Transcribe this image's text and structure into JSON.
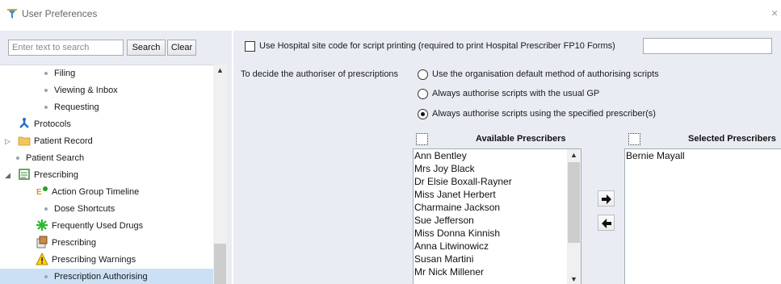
{
  "window": {
    "title": "User Preferences",
    "close_glyph": "×"
  },
  "search": {
    "placeholder": "Enter text to search",
    "search_label": "Search",
    "clear_label": "Clear"
  },
  "tree": {
    "items": [
      {
        "label": "Filing",
        "icon": "bullet"
      },
      {
        "label": "Viewing & Inbox",
        "icon": "bullet"
      },
      {
        "label": "Requesting",
        "icon": "bullet"
      },
      {
        "label": "Protocols",
        "icon": "protocols-icon"
      },
      {
        "label": "Patient Record",
        "icon": "folder-icon"
      },
      {
        "label": "Patient Search",
        "icon": "bullet"
      },
      {
        "label": "Prescribing",
        "icon": "prescribing-folder-icon"
      },
      {
        "label": "Action Group Timeline",
        "icon": "timeline-icon"
      },
      {
        "label": "Dose Shortcuts",
        "icon": "bullet"
      },
      {
        "label": "Frequently Used Drugs",
        "icon": "star-icon"
      },
      {
        "label": "Prescribing",
        "icon": "prescribing-icon"
      },
      {
        "label": "Prescribing Warnings",
        "icon": "warning-icon"
      },
      {
        "label": "Prescription Authorising",
        "icon": "bullet"
      }
    ]
  },
  "settings": {
    "hospital_site_code_label": "Use Hospital site code for script printing (required to print Hospital Prescriber FP10 Forms)",
    "authoriser_label": "To decide the authoriser of prescriptions",
    "options": [
      {
        "label": "Use the organisation default method of authorising scripts",
        "selected": false
      },
      {
        "label": "Always authorise scripts with the usual GP",
        "selected": false
      },
      {
        "label": "Always authorise scripts using the specified prescriber(s)",
        "selected": true
      }
    ]
  },
  "available": {
    "heading": "Available Prescribers",
    "items": [
      "Ann Bentley",
      "Mrs Joy Black",
      "Dr Elsie Boxall-Rayner",
      "Miss Janet Herbert",
      "Charmaine Jackson",
      "Sue Jefferson",
      "Miss Donna Kinnish",
      "Anna Litwinowicz",
      "Susan Martini",
      "Mr Nick Millener"
    ]
  },
  "selected": {
    "heading": "Selected Prescribers",
    "items": [
      "Bernie Mayall"
    ]
  },
  "colors": {
    "panel_bg": "#e9edf3",
    "selection": "#cce0f5"
  }
}
